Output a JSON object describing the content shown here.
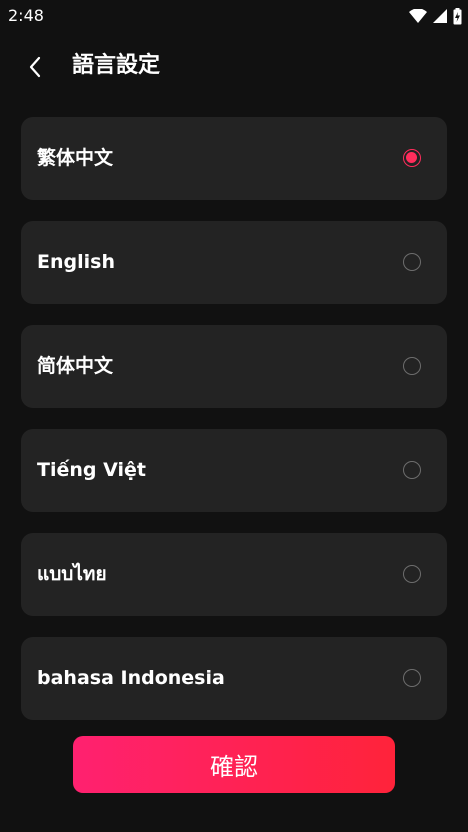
{
  "status_bar": {
    "time": "2:48",
    "icons": [
      "wifi-icon",
      "cellular-signal-icon",
      "battery-charging-icon"
    ]
  },
  "header": {
    "title": "語言設定",
    "back_icon": "chevron-left-icon"
  },
  "languages": [
    {
      "label": "繁体中文",
      "selected": true
    },
    {
      "label": "English",
      "selected": false
    },
    {
      "label": "简体中文",
      "selected": false
    },
    {
      "label": "Tiếng Việt",
      "selected": false
    },
    {
      "label": "แบบไทย",
      "selected": false
    },
    {
      "label": "bahasa Indonesia",
      "selected": false
    }
  ],
  "confirm_button": {
    "label": "確認"
  },
  "colors": {
    "background": "#111111",
    "card": "#232323",
    "accent": "#ff2d5c",
    "button_gradient_start": "#ff2170",
    "button_gradient_end": "#ff233a"
  }
}
